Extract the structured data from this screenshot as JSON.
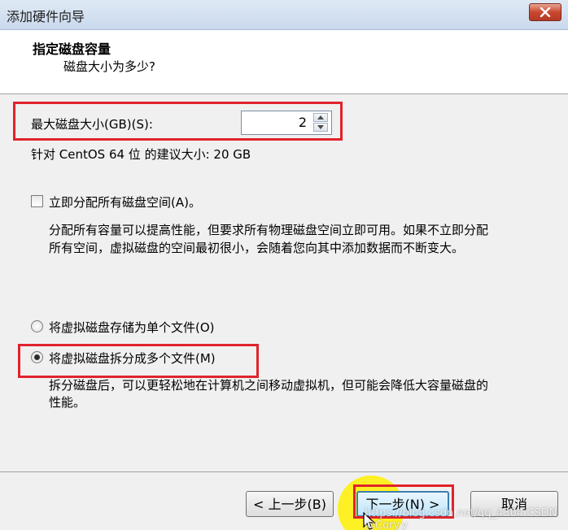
{
  "window": {
    "title": "添加硬件向导"
  },
  "header": {
    "title": "指定磁盘容量",
    "subtitle": "磁盘大小为多少?"
  },
  "disk_size": {
    "label": "最大磁盘大小(GB)(S):",
    "value": "2",
    "recommendation": "针对 CentOS 64 位 的建议大小: 20 GB"
  },
  "allocate": {
    "label": "立即分配所有磁盘空间(A)。",
    "checked": false,
    "description_line1": "分配所有容量可以提高性能，但要求所有物理磁盘空间立即可用。如果不立即分配",
    "description_line2": "所有空间，虚拟磁盘的空间最初很小，会随着您向其中添加数据而不断变大。"
  },
  "storage_options": [
    {
      "label": "将虚拟磁盘存储为单个文件(O)",
      "selected": false
    },
    {
      "label": "将虚拟磁盘拆分成多个文件(M)",
      "selected": true
    }
  ],
  "split_description_line1": "拆分磁盘后，可以更轻松地在计算机之间移动虚拟机，但可能会降低大容量磁盘的",
  "split_description_line2": "性能。",
  "buttons": {
    "back": "< 上一步(B)",
    "next": "下一步(N) >",
    "cancel": "取消"
  },
  "watermark": "https://blog.csdn.net/qq_4304 CSDN @Cory.y",
  "colors": {
    "annotation_red": "#e0232b",
    "click_highlight": "#fff000"
  },
  "icons": {
    "close": "close-x-icon",
    "spin_up": "up-arrow-icon",
    "spin_down": "down-arrow-icon",
    "cursor": "mouse-pointer-icon"
  }
}
